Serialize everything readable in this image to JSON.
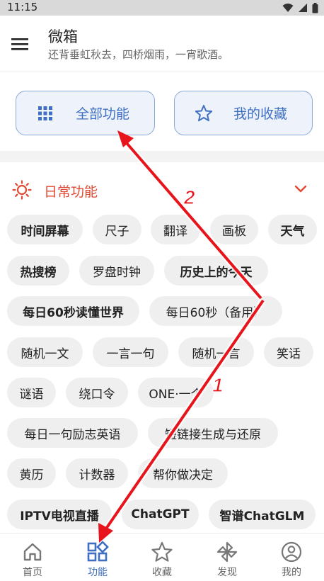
{
  "status_bar": {
    "time": "11:15"
  },
  "header": {
    "title": "微箱",
    "subtitle": "还背垂虹秋去，四桥烟雨，一宵歌酒。"
  },
  "quick_buttons": {
    "all_features": "全部功能",
    "my_favorites": "我的收藏"
  },
  "section": {
    "title": "日常功能"
  },
  "chips": [
    "时间屏幕",
    "尺子",
    "翻译",
    "画板",
    "天气",
    "热搜榜",
    "罗盘时钟",
    "历史上的今天",
    "每日60秒读懂世界",
    "每日60秒（备用）",
    "随机一文",
    "一言一句",
    "随机一言",
    "笑话",
    "谜语",
    "绕口令",
    "ONE·一个",
    "每日一句励志英语",
    "短链接生成与还原",
    "黄历",
    "计数器",
    "帮你做决定",
    "IPTV电视直播",
    "ChatGPT",
    "智谱ChatGLM"
  ],
  "bottom_nav": [
    {
      "label": "首页",
      "icon": "home-icon"
    },
    {
      "label": "功能",
      "icon": "apps-icon",
      "active": true
    },
    {
      "label": "收藏",
      "icon": "star-icon"
    },
    {
      "label": "发现",
      "icon": "pinwheel-icon"
    },
    {
      "label": "我的",
      "icon": "profile-icon"
    }
  ],
  "annotations": {
    "step1": "1",
    "step2": "2"
  },
  "colors": {
    "accent": "#3f6fc2",
    "section_red": "#e04a32",
    "arrow_red": "#e8141b",
    "chip_bg": "#efefef"
  }
}
